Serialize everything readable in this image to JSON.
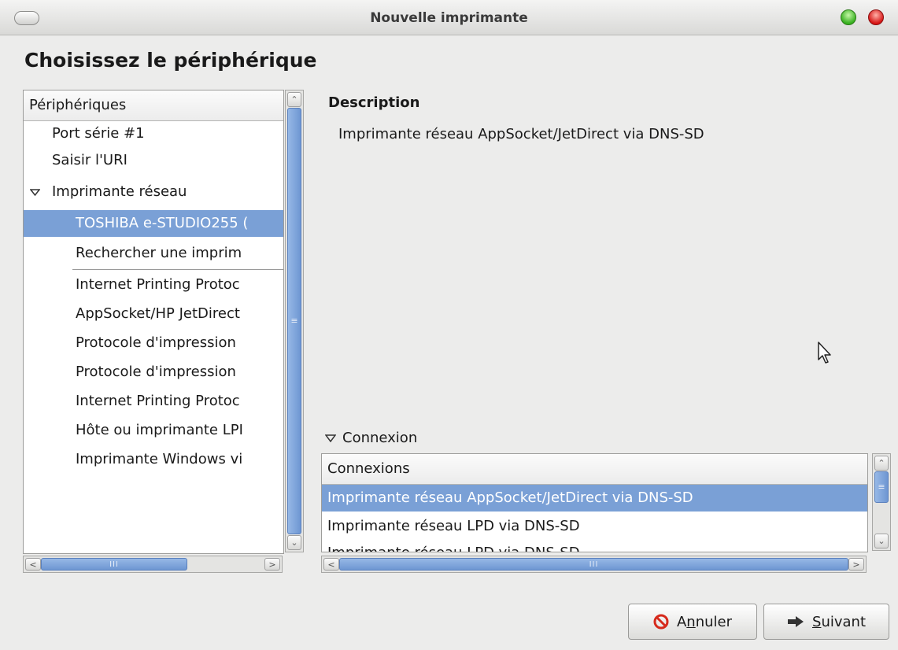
{
  "window": {
    "title": "Nouvelle imprimante"
  },
  "heading": "Choisissez le périphérique",
  "devices": {
    "column_header": "Périphériques",
    "items": [
      {
        "label": "Port série #1",
        "indent": 0
      },
      {
        "label": "Saisir l'URI",
        "indent": 0
      },
      {
        "label": "Imprimante réseau",
        "indent": 0,
        "expanded": true
      },
      {
        "label": "TOSHIBA e-STUDIO255 (",
        "indent": 1,
        "selected": true
      },
      {
        "label": "Rechercher une imprim",
        "indent": 1
      },
      {
        "label": "Internet Printing Protoc",
        "indent": 1
      },
      {
        "label": "AppSocket/HP JetDirect",
        "indent": 1
      },
      {
        "label": "Protocole d'impression",
        "indent": 1
      },
      {
        "label": "Protocole d'impression",
        "indent": 1
      },
      {
        "label": "Internet Printing Protoc",
        "indent": 1
      },
      {
        "label": "Hôte ou imprimante LPI",
        "indent": 1
      },
      {
        "label": "Imprimante Windows vi",
        "indent": 1
      }
    ]
  },
  "description": {
    "label": "Description",
    "text": "Imprimante réseau AppSocket/JetDirect via DNS-SD"
  },
  "connection": {
    "toggle_label": "Connexion",
    "expanded": true,
    "column_header": "Connexions",
    "items": [
      {
        "label": "Imprimante réseau AppSocket/JetDirect via DNS-SD",
        "selected": true
      },
      {
        "label": "Imprimante réseau LPD via DNS-SD"
      },
      {
        "label": "Imprimante réseau LPD via DNS-SD"
      }
    ]
  },
  "buttons": {
    "cancel": {
      "before": "A",
      "mnemonic": "n",
      "after": "nuler"
    },
    "next": {
      "before": "",
      "mnemonic": "S",
      "after": "uivant"
    }
  },
  "colors": {
    "selection": "#7aa0d6",
    "window_bg": "#ececeb",
    "cancel_icon": "#d62a1c"
  },
  "icons": [
    "menu-icon",
    "maximize-icon",
    "close-icon",
    "expander-open-icon",
    "cancel-icon",
    "forward-arrow-icon",
    "mouse-pointer-icon"
  ]
}
